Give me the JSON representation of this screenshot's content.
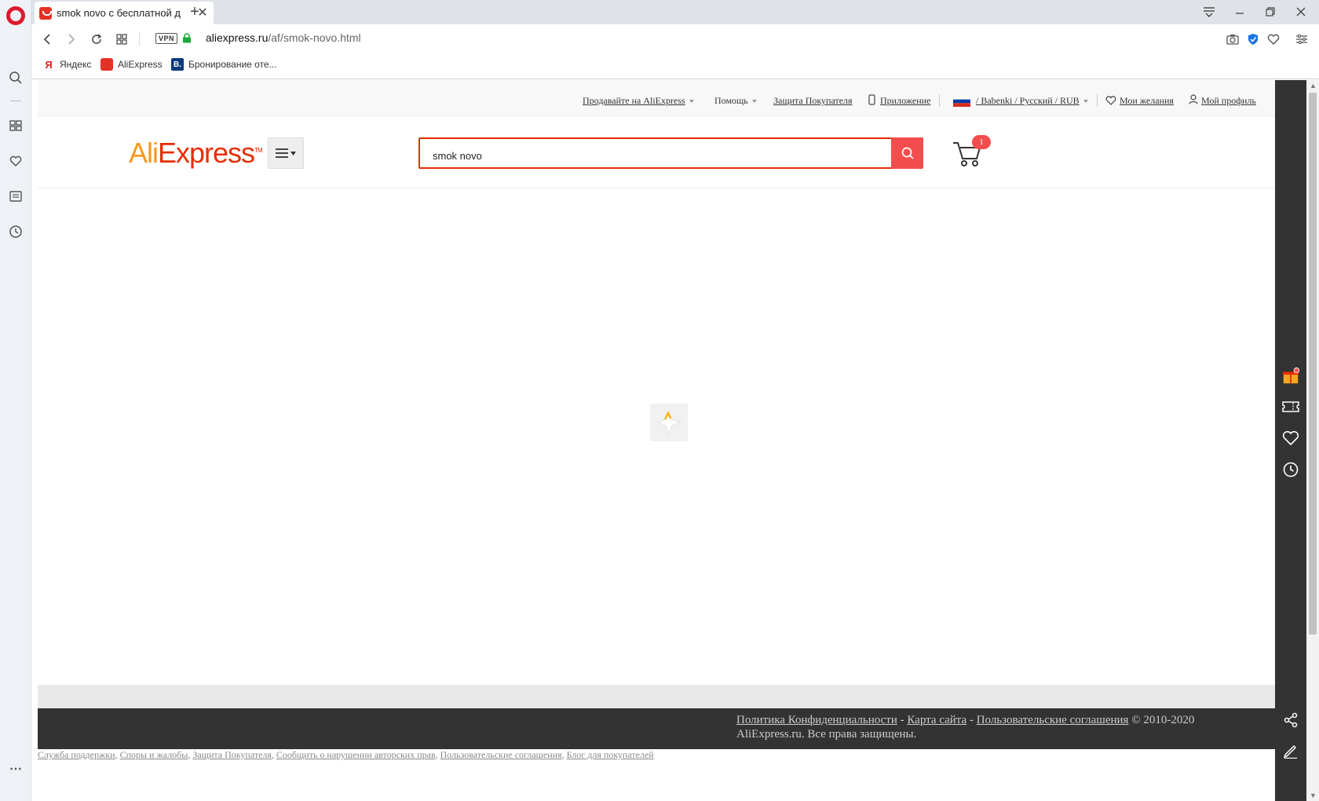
{
  "browser": {
    "tab_title": "smok novo с бесплатной д",
    "url_host": "aliexpress.ru",
    "url_path": "/af/smok-novo.html",
    "vpn_label": "VPN",
    "bookmarks": [
      {
        "label": "Яндекс",
        "icon": "yandex-icon"
      },
      {
        "label": "AliExpress",
        "icon": "aliexpress-icon"
      },
      {
        "label": "Бронирование оте...",
        "icon": "booking-icon"
      }
    ],
    "booking_glyph": "B."
  },
  "topbar": {
    "sell": "Продавайте на AliExpress",
    "help": "Помощь",
    "protection": "Защита Покупателя",
    "app": "Приложение",
    "region": "/ Babenki / Русский / RUB",
    "wishlist": "Мои желания",
    "profile": "Мой профиль"
  },
  "header": {
    "logo_ali": "Ali",
    "logo_express": "Express",
    "logo_tm": "TM",
    "search_value": "smok novo",
    "cart_count": "1"
  },
  "footer": {
    "privacy": "Политика Конфиденциальности",
    "sitemap": "Карта сайта",
    "terms": "Пользовательские соглашения",
    "copyright": "© 2010-2020 AliExpress.ru. Все права защищены.",
    "dash": "-",
    "comma": ",",
    "bottom_links": [
      "Служба поддержки",
      "Споры и жалобы",
      "Защита Покупателя",
      "Сообщить о нарушении авторских прав",
      "Пользовательские соглашения",
      "Блог для покупателей"
    ]
  },
  "colors": {
    "accent": "#e62e04",
    "search_button": "#f44d4d",
    "logo_orange": "#f7971d",
    "rail": "#333333"
  }
}
